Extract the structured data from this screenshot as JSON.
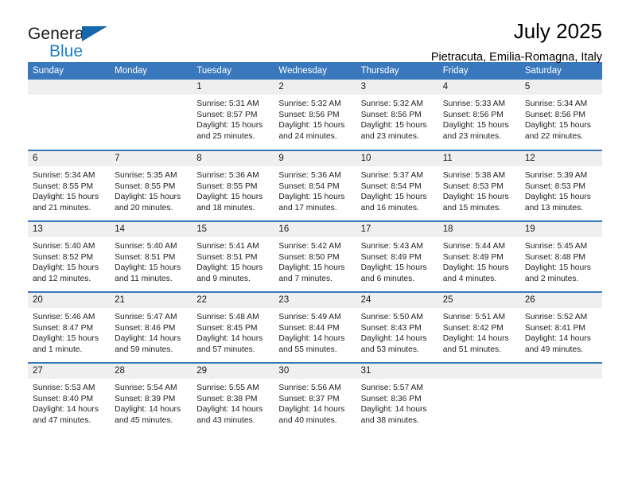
{
  "brand": {
    "name_top": "General",
    "name_bottom": "Blue",
    "accent_color": "#1566ad",
    "blue_text_color": "#1d7ec4"
  },
  "header": {
    "title": "July 2025",
    "subtitle": "Pietracuta, Emilia-Romagna, Italy"
  },
  "calendar": {
    "header_bg": "#3a78bd",
    "daynum_bg": "#efefef",
    "weekday_headers": [
      "Sunday",
      "Monday",
      "Tuesday",
      "Wednesday",
      "Thursday",
      "Friday",
      "Saturday"
    ],
    "weeks": [
      [
        {
          "day": "",
          "sunrise": "",
          "sunset": "",
          "daylight_1": "",
          "daylight_2": ""
        },
        {
          "day": "",
          "sunrise": "",
          "sunset": "",
          "daylight_1": "",
          "daylight_2": ""
        },
        {
          "day": "1",
          "sunrise": "Sunrise: 5:31 AM",
          "sunset": "Sunset: 8:57 PM",
          "daylight_1": "Daylight: 15 hours",
          "daylight_2": "and 25 minutes."
        },
        {
          "day": "2",
          "sunrise": "Sunrise: 5:32 AM",
          "sunset": "Sunset: 8:56 PM",
          "daylight_1": "Daylight: 15 hours",
          "daylight_2": "and 24 minutes."
        },
        {
          "day": "3",
          "sunrise": "Sunrise: 5:32 AM",
          "sunset": "Sunset: 8:56 PM",
          "daylight_1": "Daylight: 15 hours",
          "daylight_2": "and 23 minutes."
        },
        {
          "day": "4",
          "sunrise": "Sunrise: 5:33 AM",
          "sunset": "Sunset: 8:56 PM",
          "daylight_1": "Daylight: 15 hours",
          "daylight_2": "and 23 minutes."
        },
        {
          "day": "5",
          "sunrise": "Sunrise: 5:34 AM",
          "sunset": "Sunset: 8:56 PM",
          "daylight_1": "Daylight: 15 hours",
          "daylight_2": "and 22 minutes."
        }
      ],
      [
        {
          "day": "6",
          "sunrise": "Sunrise: 5:34 AM",
          "sunset": "Sunset: 8:55 PM",
          "daylight_1": "Daylight: 15 hours",
          "daylight_2": "and 21 minutes."
        },
        {
          "day": "7",
          "sunrise": "Sunrise: 5:35 AM",
          "sunset": "Sunset: 8:55 PM",
          "daylight_1": "Daylight: 15 hours",
          "daylight_2": "and 20 minutes."
        },
        {
          "day": "8",
          "sunrise": "Sunrise: 5:36 AM",
          "sunset": "Sunset: 8:55 PM",
          "daylight_1": "Daylight: 15 hours",
          "daylight_2": "and 18 minutes."
        },
        {
          "day": "9",
          "sunrise": "Sunrise: 5:36 AM",
          "sunset": "Sunset: 8:54 PM",
          "daylight_1": "Daylight: 15 hours",
          "daylight_2": "and 17 minutes."
        },
        {
          "day": "10",
          "sunrise": "Sunrise: 5:37 AM",
          "sunset": "Sunset: 8:54 PM",
          "daylight_1": "Daylight: 15 hours",
          "daylight_2": "and 16 minutes."
        },
        {
          "day": "11",
          "sunrise": "Sunrise: 5:38 AM",
          "sunset": "Sunset: 8:53 PM",
          "daylight_1": "Daylight: 15 hours",
          "daylight_2": "and 15 minutes."
        },
        {
          "day": "12",
          "sunrise": "Sunrise: 5:39 AM",
          "sunset": "Sunset: 8:53 PM",
          "daylight_1": "Daylight: 15 hours",
          "daylight_2": "and 13 minutes."
        }
      ],
      [
        {
          "day": "13",
          "sunrise": "Sunrise: 5:40 AM",
          "sunset": "Sunset: 8:52 PM",
          "daylight_1": "Daylight: 15 hours",
          "daylight_2": "and 12 minutes."
        },
        {
          "day": "14",
          "sunrise": "Sunrise: 5:40 AM",
          "sunset": "Sunset: 8:51 PM",
          "daylight_1": "Daylight: 15 hours",
          "daylight_2": "and 11 minutes."
        },
        {
          "day": "15",
          "sunrise": "Sunrise: 5:41 AM",
          "sunset": "Sunset: 8:51 PM",
          "daylight_1": "Daylight: 15 hours",
          "daylight_2": "and 9 minutes."
        },
        {
          "day": "16",
          "sunrise": "Sunrise: 5:42 AM",
          "sunset": "Sunset: 8:50 PM",
          "daylight_1": "Daylight: 15 hours",
          "daylight_2": "and 7 minutes."
        },
        {
          "day": "17",
          "sunrise": "Sunrise: 5:43 AM",
          "sunset": "Sunset: 8:49 PM",
          "daylight_1": "Daylight: 15 hours",
          "daylight_2": "and 6 minutes."
        },
        {
          "day": "18",
          "sunrise": "Sunrise: 5:44 AM",
          "sunset": "Sunset: 8:49 PM",
          "daylight_1": "Daylight: 15 hours",
          "daylight_2": "and 4 minutes."
        },
        {
          "day": "19",
          "sunrise": "Sunrise: 5:45 AM",
          "sunset": "Sunset: 8:48 PM",
          "daylight_1": "Daylight: 15 hours",
          "daylight_2": "and 2 minutes."
        }
      ],
      [
        {
          "day": "20",
          "sunrise": "Sunrise: 5:46 AM",
          "sunset": "Sunset: 8:47 PM",
          "daylight_1": "Daylight: 15 hours",
          "daylight_2": "and 1 minute."
        },
        {
          "day": "21",
          "sunrise": "Sunrise: 5:47 AM",
          "sunset": "Sunset: 8:46 PM",
          "daylight_1": "Daylight: 14 hours",
          "daylight_2": "and 59 minutes."
        },
        {
          "day": "22",
          "sunrise": "Sunrise: 5:48 AM",
          "sunset": "Sunset: 8:45 PM",
          "daylight_1": "Daylight: 14 hours",
          "daylight_2": "and 57 minutes."
        },
        {
          "day": "23",
          "sunrise": "Sunrise: 5:49 AM",
          "sunset": "Sunset: 8:44 PM",
          "daylight_1": "Daylight: 14 hours",
          "daylight_2": "and 55 minutes."
        },
        {
          "day": "24",
          "sunrise": "Sunrise: 5:50 AM",
          "sunset": "Sunset: 8:43 PM",
          "daylight_1": "Daylight: 14 hours",
          "daylight_2": "and 53 minutes."
        },
        {
          "day": "25",
          "sunrise": "Sunrise: 5:51 AM",
          "sunset": "Sunset: 8:42 PM",
          "daylight_1": "Daylight: 14 hours",
          "daylight_2": "and 51 minutes."
        },
        {
          "day": "26",
          "sunrise": "Sunrise: 5:52 AM",
          "sunset": "Sunset: 8:41 PM",
          "daylight_1": "Daylight: 14 hours",
          "daylight_2": "and 49 minutes."
        }
      ],
      [
        {
          "day": "27",
          "sunrise": "Sunrise: 5:53 AM",
          "sunset": "Sunset: 8:40 PM",
          "daylight_1": "Daylight: 14 hours",
          "daylight_2": "and 47 minutes."
        },
        {
          "day": "28",
          "sunrise": "Sunrise: 5:54 AM",
          "sunset": "Sunset: 8:39 PM",
          "daylight_1": "Daylight: 14 hours",
          "daylight_2": "and 45 minutes."
        },
        {
          "day": "29",
          "sunrise": "Sunrise: 5:55 AM",
          "sunset": "Sunset: 8:38 PM",
          "daylight_1": "Daylight: 14 hours",
          "daylight_2": "and 43 minutes."
        },
        {
          "day": "30",
          "sunrise": "Sunrise: 5:56 AM",
          "sunset": "Sunset: 8:37 PM",
          "daylight_1": "Daylight: 14 hours",
          "daylight_2": "and 40 minutes."
        },
        {
          "day": "31",
          "sunrise": "Sunrise: 5:57 AM",
          "sunset": "Sunset: 8:36 PM",
          "daylight_1": "Daylight: 14 hours",
          "daylight_2": "and 38 minutes."
        },
        {
          "day": "",
          "sunrise": "",
          "sunset": "",
          "daylight_1": "",
          "daylight_2": ""
        },
        {
          "day": "",
          "sunrise": "",
          "sunset": "",
          "daylight_1": "",
          "daylight_2": ""
        }
      ]
    ]
  }
}
